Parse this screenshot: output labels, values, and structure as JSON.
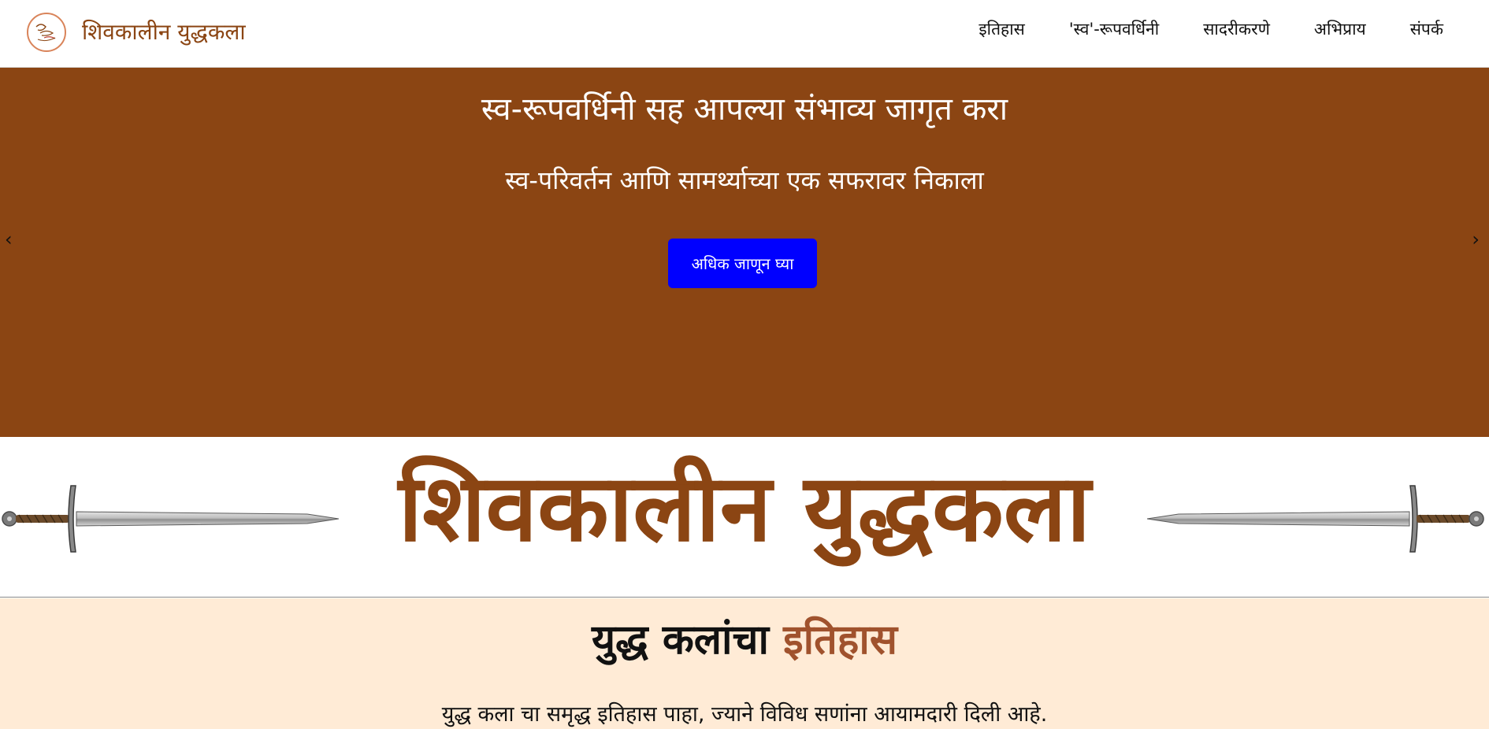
{
  "navbar": {
    "brand_title": "शिवकालीन युद्धकला",
    "links": [
      "इतिहास",
      "'स्व'-रूपवर्धिनी",
      "सादरीकरणे",
      "अभिप्राय",
      "संपर्क"
    ]
  },
  "hero": {
    "title": "स्व-रूपवर्धिनी सह आपल्या संभाव्य जागृत करा",
    "subtitle": "स्व-परिवर्तन आणि सामर्थ्याच्या एक सफरावर निकाला",
    "button_label": "अधिक जाणून घ्या",
    "prev_arrow": "‹",
    "next_arrow": "›"
  },
  "banner": {
    "title": "शिवकालीन युद्धकला",
    "left_icon": "sword-icon",
    "right_icon": "sword-icon"
  },
  "history": {
    "heading_main": "युद्ध कलांचा ",
    "heading_accent": "इतिहास",
    "text": "युद्ध कला चा समृद्ध इतिहास पाहा, ज्याने विविध सणांना आयामदारी दिली आहे."
  },
  "colors": {
    "brand": "#8b4513",
    "hero_bg": "#8b4513",
    "button_bg": "#0000ff",
    "history_bg": "#ffebd6",
    "accent": "#a0522d"
  }
}
